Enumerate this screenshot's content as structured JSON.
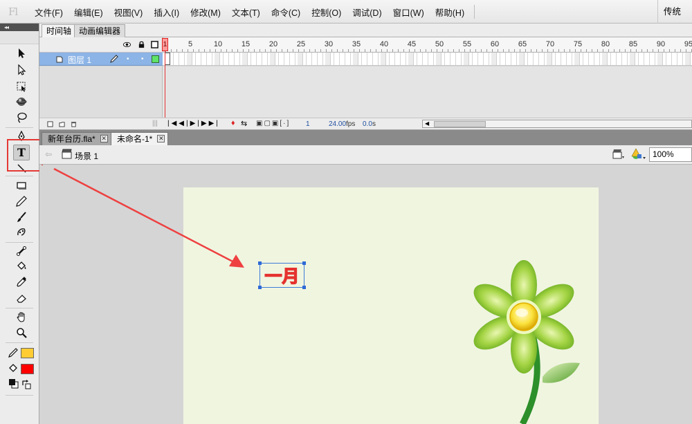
{
  "app": {
    "logo": "Fl"
  },
  "menu": {
    "items": [
      "文件(F)",
      "编辑(E)",
      "视图(V)",
      "插入(I)",
      "修改(M)",
      "文本(T)",
      "命令(C)",
      "控制(O)",
      "调试(D)",
      "窗口(W)",
      "帮助(H)"
    ],
    "workspace": "传统"
  },
  "timeline": {
    "tabs": [
      "时间轴",
      "动画编辑器"
    ],
    "active_tab": "时间轴",
    "ruler": [
      "1",
      "5",
      "10",
      "15",
      "20",
      "25",
      "30",
      "35",
      "40",
      "45",
      "50",
      "55",
      "60",
      "65",
      "70",
      "75",
      "80",
      "85",
      "90",
      "95"
    ],
    "layer_name": "图层 1",
    "current_frame": "1",
    "frame_rate": "24.00",
    "fps_unit": "fps",
    "elapsed": "0.0",
    "elapsed_unit": "s"
  },
  "documents": {
    "tabs": [
      "新年台历.fla*",
      "未命名-1*"
    ],
    "active_index": 1
  },
  "edit_bar": {
    "scene": "场景 1",
    "zoom": "100%"
  },
  "stage": {
    "text": "一月",
    "background": "#f0f5e0",
    "text_color": "#e5322e"
  },
  "tools": {
    "items": [
      "selection-tool",
      "subselection-tool",
      "free-transform-tool",
      "3d-rotation-tool",
      "lasso-tool",
      "pen-tool",
      "text-tool",
      "line-tool",
      "rectangle-tool",
      "pencil-tool",
      "brush-tool",
      "deco-tool",
      "bone-tool",
      "paint-bucket-tool",
      "eyedropper-tool",
      "eraser-tool",
      "hand-tool",
      "zoom-tool"
    ],
    "stroke_color": "#ffcc33",
    "fill_color": "#ff0000",
    "highlight_color": "#e53935"
  }
}
